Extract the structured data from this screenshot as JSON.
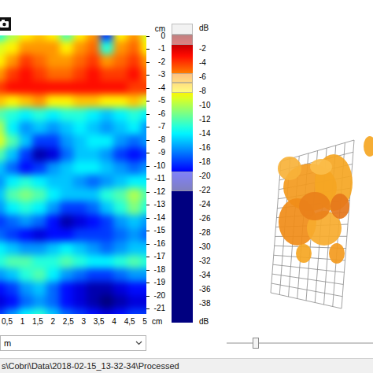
{
  "heatmap": {
    "y_unit": "cm",
    "y_ticks": [
      "0",
      "-1",
      "-2",
      "-3",
      "-4",
      "-5",
      "-6",
      "-7",
      "-8",
      "-9",
      "-10",
      "-11",
      "-12",
      "-13",
      "-14",
      "-15",
      "-16",
      "-17",
      "-18",
      "-19",
      "-20",
      "-21"
    ],
    "x_ticks": [
      "0,5",
      "1",
      "1,5",
      "2",
      "2,5",
      "3",
      "3,5",
      "4",
      "4,5",
      "5"
    ],
    "x_unit": "cm",
    "values_db": [
      [
        -13,
        -10,
        -8,
        -7,
        -8,
        -12,
        -8,
        -6,
        -18,
        -8,
        -6,
        -9
      ],
      [
        -9,
        -8,
        -6,
        -6,
        -6,
        -8,
        -6,
        -5,
        -13,
        -6,
        -5,
        -8
      ],
      [
        -8,
        -6,
        -4,
        -5,
        -6,
        -6,
        -5,
        -4,
        -6,
        -5,
        -4,
        -6
      ],
      [
        -6,
        -4,
        -3,
        -4,
        -5,
        -5,
        -4,
        -3,
        -4,
        -4,
        -3,
        -5
      ],
      [
        -4,
        -3,
        -3,
        -3,
        -3,
        -3,
        -3,
        -3,
        -3,
        -3,
        -4,
        -4
      ],
      [
        -7,
        -8,
        -7,
        -6,
        -8,
        -8,
        -7,
        -7,
        -8,
        -8,
        -7,
        -9
      ],
      [
        -12,
        -13,
        -14,
        -13,
        -14,
        -13,
        -13,
        -14,
        -15,
        -14,
        -13,
        -14
      ],
      [
        -10,
        -14,
        -16,
        -15,
        -16,
        -15,
        -14,
        -15,
        -16,
        -15,
        -14,
        -16
      ],
      [
        -9,
        -12,
        -15,
        -18,
        -18,
        -16,
        -15,
        -14,
        -14,
        -16,
        -17,
        -16
      ],
      [
        -12,
        -15,
        -18,
        -21,
        -20,
        -17,
        -15,
        -15,
        -16,
        -18,
        -19,
        -18
      ],
      [
        -15,
        -17,
        -19,
        -18,
        -16,
        -15,
        -14,
        -14,
        -15,
        -16,
        -17,
        -16
      ],
      [
        -16,
        -14,
        -13,
        -14,
        -15,
        -15,
        -16,
        -17,
        -16,
        -15,
        -14,
        -14
      ],
      [
        -15,
        -12,
        -11,
        -12,
        -14,
        -15,
        -15,
        -15,
        -13,
        -12,
        -10,
        -12
      ],
      [
        -16,
        -14,
        -13,
        -14,
        -16,
        -18,
        -18,
        -17,
        -15,
        -13,
        -11,
        -13
      ],
      [
        -18,
        -17,
        -16,
        -17,
        -19,
        -21,
        -20,
        -19,
        -18,
        -16,
        -15,
        -16
      ],
      [
        -17,
        -18,
        -19,
        -20,
        -19,
        -19,
        -18,
        -18,
        -18,
        -17,
        -16,
        -17
      ],
      [
        -14,
        -15,
        -16,
        -16,
        -15,
        -14,
        -15,
        -16,
        -17,
        -16,
        -15,
        -15
      ],
      [
        -13,
        -12,
        -12,
        -13,
        -13,
        -12,
        -13,
        -14,
        -14,
        -13,
        -12,
        -13
      ],
      [
        -16,
        -15,
        -13,
        -12,
        -14,
        -16,
        -17,
        -18,
        -18,
        -17,
        -16,
        -16
      ],
      [
        -19,
        -18,
        -16,
        -15,
        -17,
        -19,
        -20,
        -21,
        -21,
        -20,
        -19,
        -19
      ],
      [
        -20,
        -19,
        -17,
        -16,
        -17,
        -19,
        -20,
        -21,
        -22,
        -21,
        -20,
        -20
      ],
      [
        -18,
        -16,
        -14,
        -13,
        -15,
        -17,
        -18,
        -19,
        -20,
        -19,
        -18,
        -18
      ]
    ]
  },
  "colorbar": {
    "unit_top": "dB",
    "unit_bottom": "dB",
    "ticks": [
      "-2",
      "-4",
      "-6",
      "-8",
      "-10",
      "-12",
      "-14",
      "-16",
      "-18",
      "-20",
      "-22",
      "-24",
      "-26",
      "-28",
      "-30",
      "-32",
      "-34",
      "-36",
      "-38"
    ],
    "max_db": 0,
    "min_db": -40,
    "highlights": [
      {
        "from": 0,
        "to": -1.4
      },
      {
        "from": -5.4,
        "to": -6.8
      },
      {
        "from": -6.8,
        "to": -8.2
      },
      {
        "from": -19.3,
        "to": -22.1
      }
    ]
  },
  "view_select": {
    "value": "m"
  },
  "slider": {
    "level": 0.2
  },
  "status_bar": {
    "path": "s\\Cobri\\Data\\2018-02-15_13-32-34\\Processed"
  }
}
